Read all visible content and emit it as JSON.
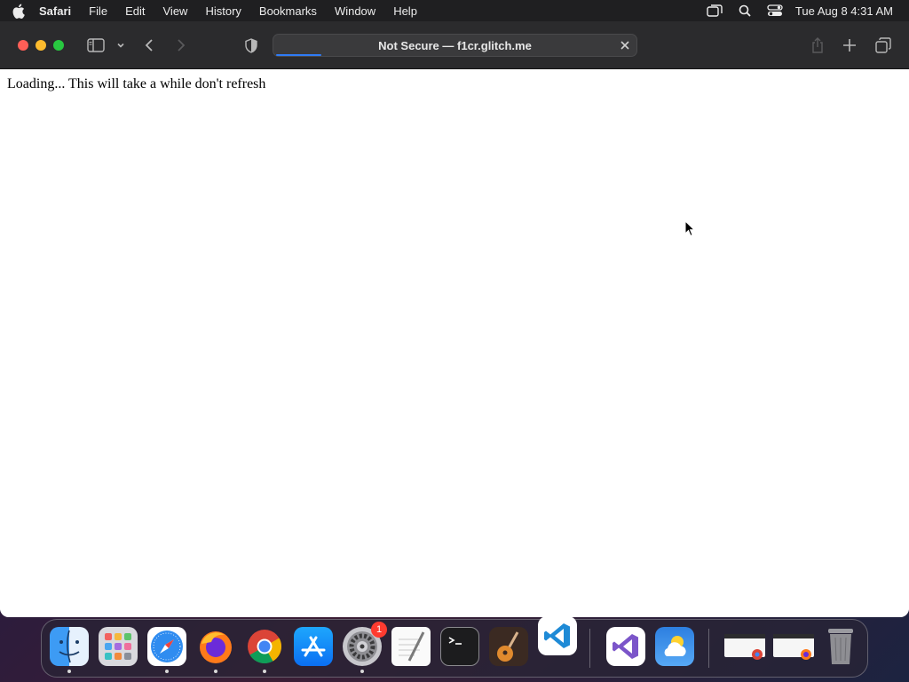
{
  "menubar": {
    "app_name": "Safari",
    "menus": [
      "File",
      "Edit",
      "View",
      "History",
      "Bookmarks",
      "Window",
      "Help"
    ],
    "clock": "Tue Aug 8  4:31 AM",
    "status_icons": [
      "screen-mirroring-icon",
      "spotlight-search-icon",
      "control-center-icon"
    ]
  },
  "browser": {
    "address_text": "Not Secure — f1cr.glitch.me",
    "load_progress_fraction": 0.125,
    "toolbar_icons": [
      "sidebar-icon",
      "chevron-down-icon",
      "back-icon",
      "forward-icon",
      "privacy-shield-icon",
      "clear-icon",
      "share-icon",
      "new-tab-icon",
      "tab-overview-icon"
    ]
  },
  "page": {
    "loading_text": "Loading... This will take a while don't refresh"
  },
  "dock": {
    "apps": [
      "Finder",
      "Launchpad",
      "Safari",
      "Firefox",
      "Google Chrome",
      "App Store",
      "System Settings",
      "TextEdit",
      "Terminal",
      "GarageBand",
      "Visual Studio Code",
      "Visual Studio",
      "Weather",
      "Chrome window",
      "Firefox window",
      "Trash"
    ],
    "settings_badge": "1"
  },
  "colors": {
    "menubar_bg": "#1f1f21",
    "toolbar_bg": "#2b2b2d",
    "progress": "#2f7cf6",
    "close": "#fe5f57",
    "minimize": "#febc2e",
    "maximize": "#28c840"
  }
}
